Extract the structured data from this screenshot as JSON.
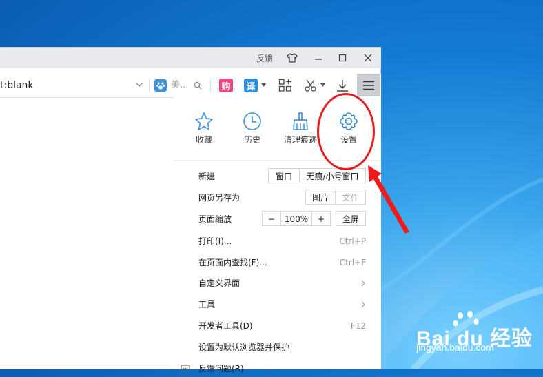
{
  "titlebar": {
    "feedback_label": "反馈",
    "skin_icon": "tshirt-icon",
    "minimize_icon": "minimize-icon",
    "maximize_icon": "maximize-icon",
    "close_icon": "close-icon"
  },
  "toolbar": {
    "address_text": "t:blank",
    "search_engine_placeholder": "美...",
    "shopping_label": "购",
    "translate_label": "译",
    "icons": [
      "baidu-paw-icon",
      "search-icon",
      "apps-add-icon",
      "scissors-icon",
      "download-icon",
      "hamburger-menu-icon"
    ]
  },
  "menu": {
    "quick_actions": [
      {
        "label": "收藏",
        "icon": "star-icon"
      },
      {
        "label": "历史",
        "icon": "clock-icon"
      },
      {
        "label": "清理痕迹",
        "icon": "broom-icon"
      },
      {
        "label": "设置",
        "icon": "gear-icon"
      }
    ],
    "new": {
      "label": "新建",
      "window": "窗口",
      "incognito": "无痕/小号窗口"
    },
    "save_as": {
      "label": "网页另存为",
      "image": "图片",
      "file": "文件"
    },
    "zoom": {
      "label": "页面缩放",
      "minus": "−",
      "value": "100%",
      "plus": "+",
      "fullscreen": "全屏"
    },
    "print": {
      "label": "打印(I)...",
      "shortcut": "Ctrl+P"
    },
    "find": {
      "label": "在页面内查找(F)...",
      "shortcut": "Ctrl+F"
    },
    "customize": {
      "label": "自定义界面"
    },
    "tools": {
      "label": "工具"
    },
    "devtools": {
      "label": "开发者工具(D)",
      "shortcut": "F12"
    },
    "default_browser": {
      "label": "设置为默认浏览器并保护"
    },
    "report": {
      "label": "反馈问题(R)"
    }
  },
  "watermark": {
    "brand": "Bai du 经验",
    "url": "jingyan.baidu.com"
  },
  "colors": {
    "accent_blue": "#3b8fd9",
    "annotation_red": "#e81c1c",
    "titlebar_bg": "#e8eaed",
    "active_button_bg": "#c9ccd1"
  }
}
